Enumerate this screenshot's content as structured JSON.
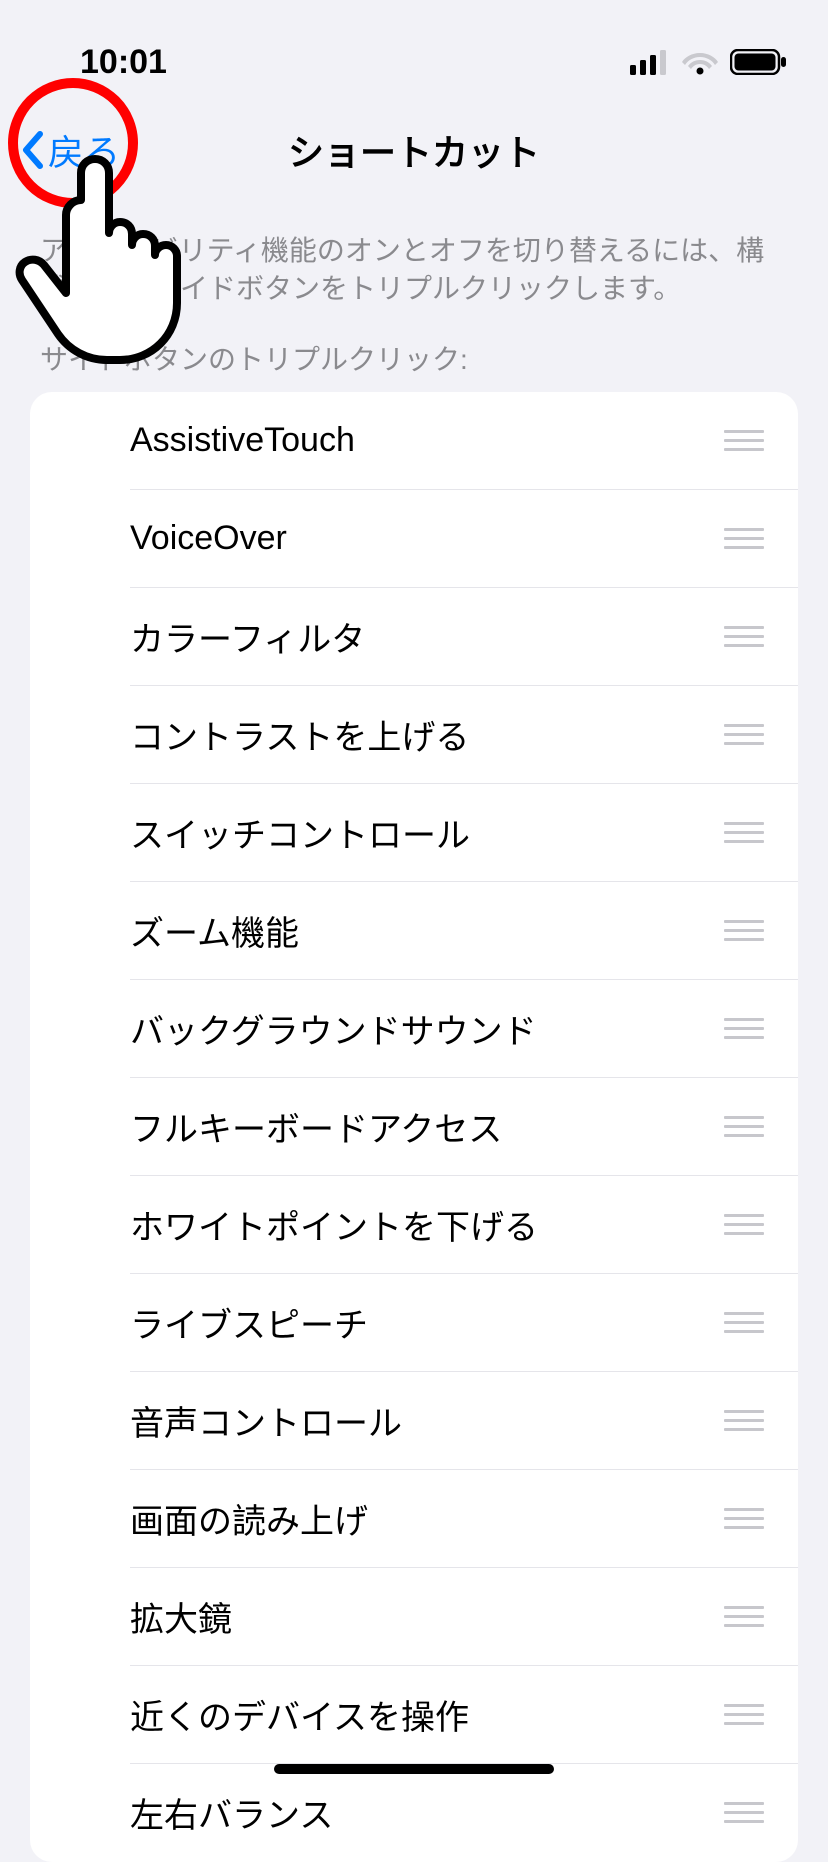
{
  "status": {
    "time": "10:01"
  },
  "nav": {
    "back_label": "戻る",
    "title": "ショートカット"
  },
  "description": "アクセシビリティ機能のオンとオフを切り替えるには、構成済みのサイドボタンをトリプルクリックします。",
  "section_header": "サイドボタンのトリプルクリック:",
  "items": [
    {
      "label": "AssistiveTouch"
    },
    {
      "label": "VoiceOver"
    },
    {
      "label": "カラーフィルタ"
    },
    {
      "label": "コントラストを上げる"
    },
    {
      "label": "スイッチコントロール"
    },
    {
      "label": "ズーム機能"
    },
    {
      "label": "バックグラウンドサウンド"
    },
    {
      "label": "フルキーボードアクセス"
    },
    {
      "label": "ホワイトポイントを下げる"
    },
    {
      "label": "ライブスピーチ"
    },
    {
      "label": "音声コントロール"
    },
    {
      "label": "画面の読み上げ"
    },
    {
      "label": "拡大鏡"
    },
    {
      "label": "近くのデバイスを操作"
    },
    {
      "label": "左右バランス"
    }
  ]
}
